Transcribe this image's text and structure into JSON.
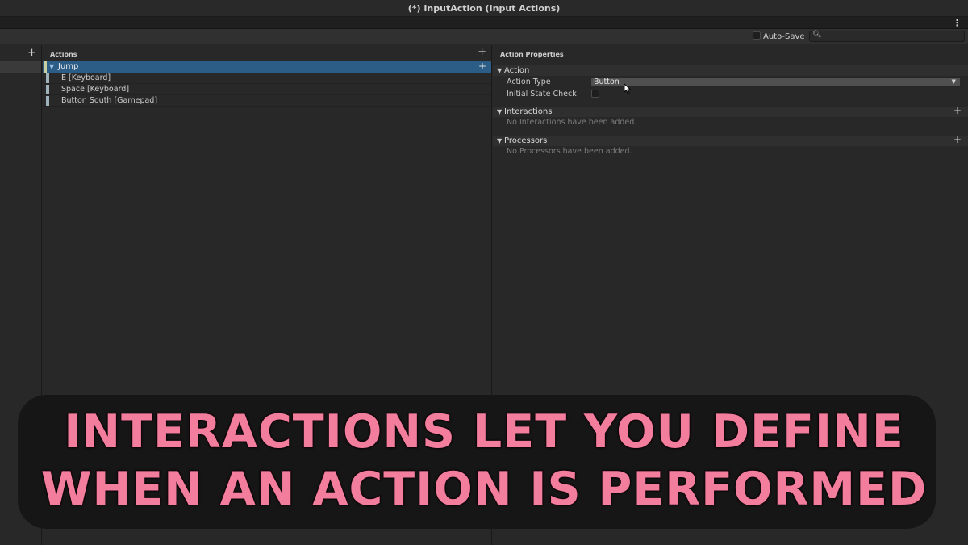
{
  "window": {
    "title": "(*) InputAction (Input Actions)"
  },
  "toolbar": {
    "autosave_label": "Auto-Save",
    "search_placeholder": ""
  },
  "actions_panel": {
    "header": "Actions",
    "action": {
      "name": "Jump"
    },
    "bindings": [
      {
        "label": "E [Keyboard]"
      },
      {
        "label": "Space [Keyboard]"
      },
      {
        "label": "Button South [Gamepad]"
      }
    ]
  },
  "properties_panel": {
    "header": "Action Properties",
    "action_section": {
      "title": "Action",
      "action_type_label": "Action Type",
      "action_type_value": "Button",
      "initial_state_label": "Initial State Check"
    },
    "interactions_section": {
      "title": "Interactions",
      "empty_text": "No Interactions have been added."
    },
    "processors_section": {
      "title": "Processors",
      "empty_text": "No Processors have been added."
    }
  },
  "caption": {
    "line1": "INTERACTIONS LET YOU DEFINE",
    "line2": "WHEN AN ACTION IS PERFORMED"
  },
  "colors": {
    "selected_row": "#2c5d87",
    "caption_text": "#f37d9d",
    "caption_bg": "#161616"
  }
}
